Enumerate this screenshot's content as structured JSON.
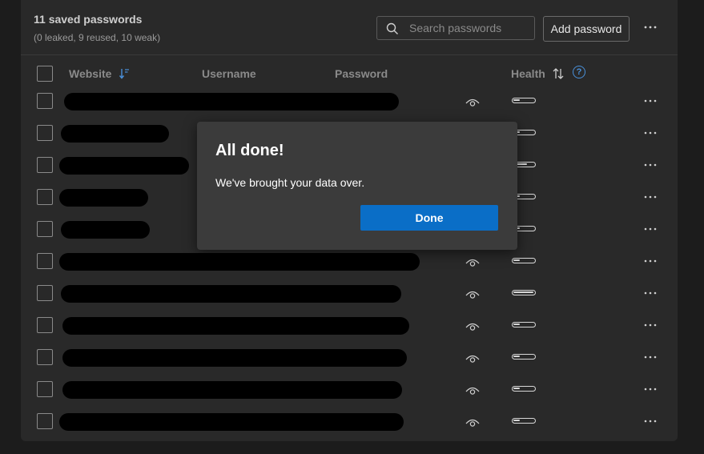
{
  "header": {
    "title": "11 saved passwords",
    "subtitle": "(0 leaked, 9 reused, 10 weak)"
  },
  "search": {
    "placeholder": "Search passwords",
    "value": ""
  },
  "toolbar": {
    "add_label": "Add password",
    "more_icon": "more-horizontal-icon"
  },
  "columns": {
    "website": "Website",
    "username": "Username",
    "password": "Password",
    "health": "Health",
    "help": "?"
  },
  "rows": [
    {
      "health_level": 0.33,
      "website_redacted": true
    },
    {
      "health_level": 0.33,
      "website_redacted": true
    },
    {
      "health_level": 0.66,
      "website_redacted": true
    },
    {
      "health_level": 0.33,
      "website_redacted": true
    },
    {
      "health_level": 0.33,
      "website_redacted": true
    },
    {
      "health_level": 0.33,
      "website_redacted": true
    },
    {
      "health_level": 1.0,
      "website_redacted": true
    },
    {
      "health_level": 0.33,
      "website_redacted": true
    },
    {
      "health_level": 0.33,
      "website_redacted": true
    },
    {
      "health_level": 0.33,
      "website_redacted": true
    },
    {
      "health_level": 0.33,
      "website_redacted": true
    }
  ],
  "dialog": {
    "title": "All done!",
    "message": "We've brought your data over.",
    "done_label": "Done"
  },
  "colors": {
    "accent": "#0a6ec7",
    "panel": "#292929",
    "background": "#1c1c1c",
    "dialog": "#3b3b3b",
    "help": "#4a90d9"
  }
}
